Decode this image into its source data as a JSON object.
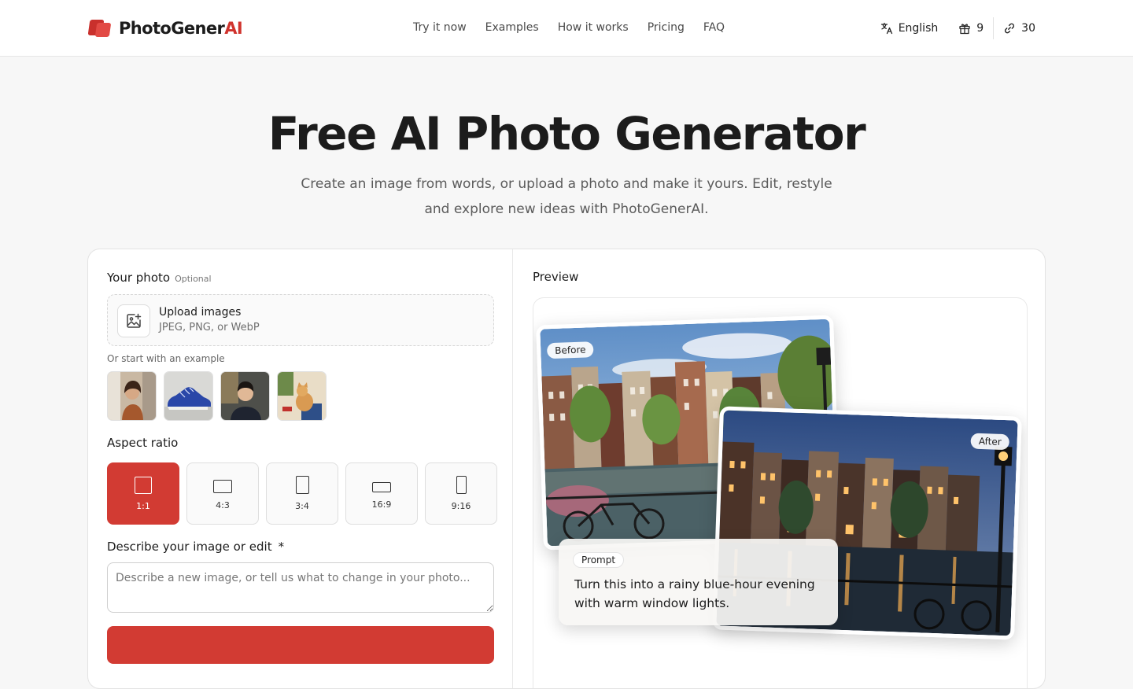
{
  "header": {
    "logo_text": "PhotoGener",
    "logo_ai": "AI",
    "nav": [
      "Try it now",
      "Examples",
      "How it works",
      "Pricing",
      "FAQ"
    ],
    "language": "English",
    "gift_count": "9",
    "credits_count": "30"
  },
  "hero": {
    "title": "Free AI Photo Generator",
    "subtitle": "Create an image from words, or upload a photo and make it yours. Edit, restyle and explore new ideas with PhotoGenerAI."
  },
  "form": {
    "photo_label": "Your photo",
    "photo_optional": "Optional",
    "upload_title": "Upload images",
    "upload_formats": "JPEG, PNG, or WebP",
    "examples_label": "Or start with an example",
    "example_thumbs": [
      "woman-in-street-thumb",
      "blue-sneaker-thumb",
      "man-portrait-thumb",
      "cat-on-chair-thumb"
    ],
    "aspect_label": "Aspect ratio",
    "aspect_ratios": [
      "1:1",
      "4:3",
      "3:4",
      "16:9",
      "9:16"
    ],
    "aspect_selected": "1:1",
    "describe_label": "Describe your image or edit",
    "required_mark": "*",
    "describe_placeholder": "Describe a new image, or tell us what to change in your photo..."
  },
  "preview": {
    "label": "Preview",
    "before_tag": "Before",
    "after_tag": "After",
    "prompt_tag": "Prompt",
    "prompt_text": "Turn this into a rainy blue-hour evening with warm window lights."
  },
  "colors": {
    "accent": "#d23b33",
    "background": "#f7f7f7"
  }
}
